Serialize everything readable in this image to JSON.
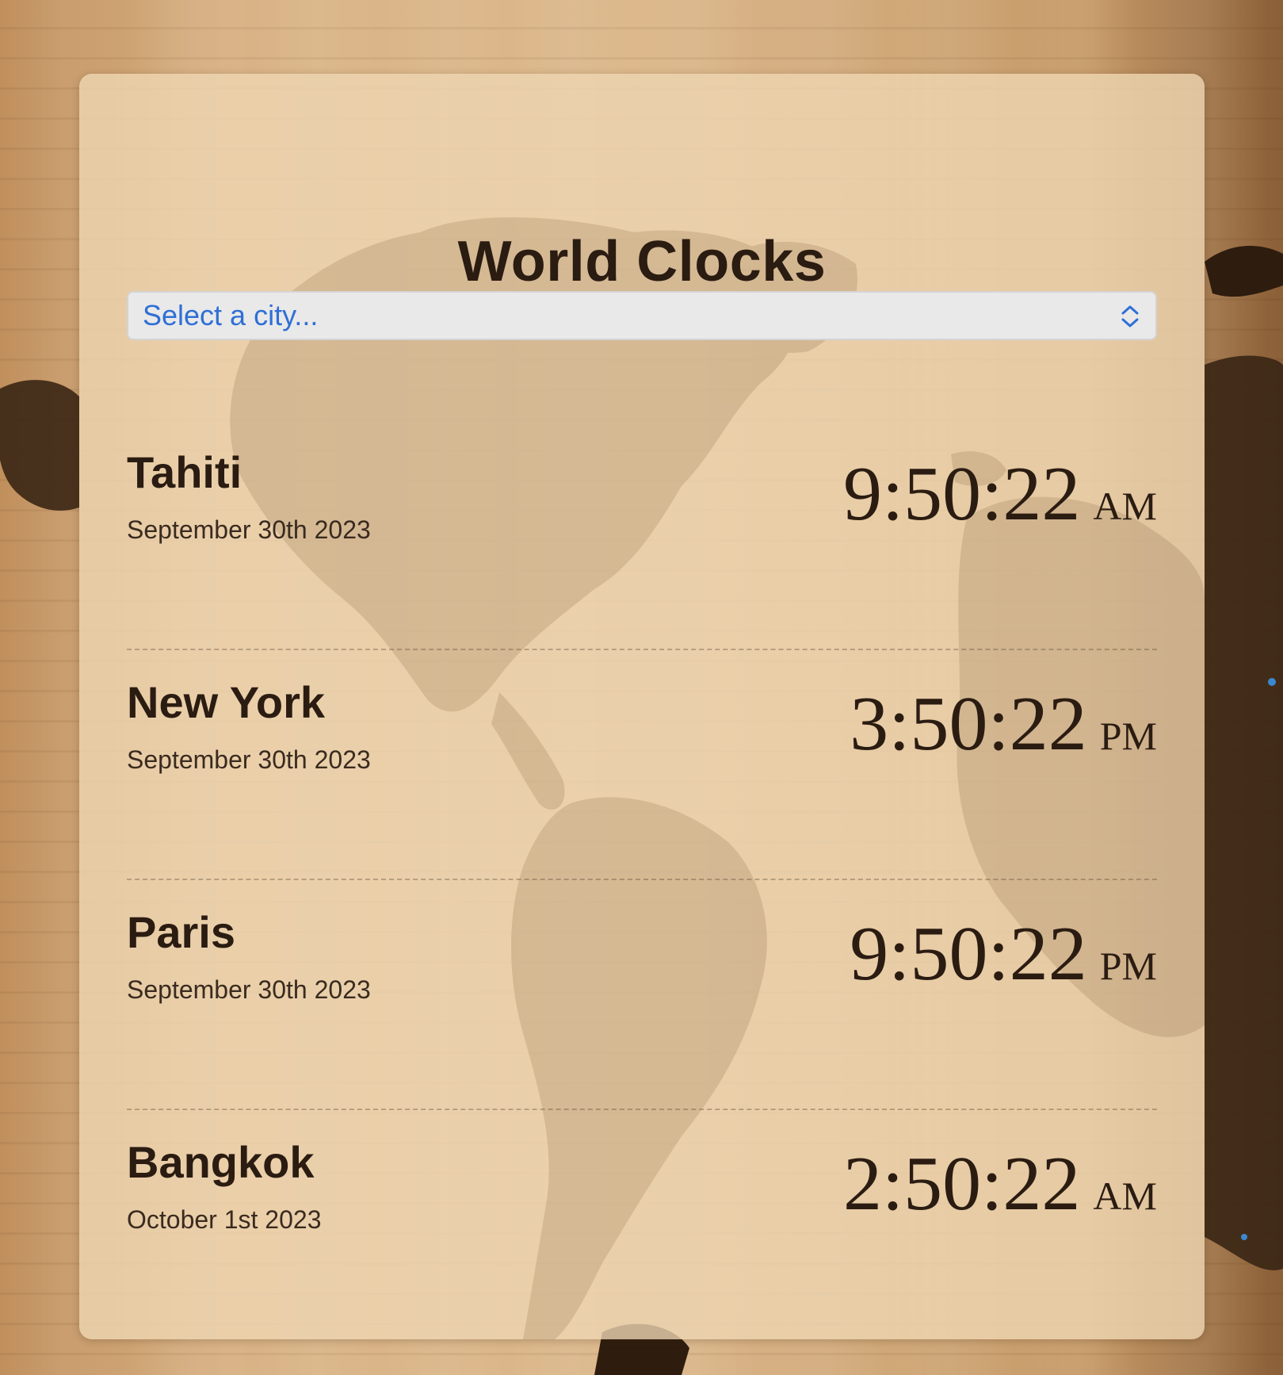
{
  "app": {
    "title": "World Clocks"
  },
  "city_select": {
    "placeholder": "Select a city..."
  },
  "clocks": [
    {
      "city": "Tahiti",
      "date": "September 30th 2023",
      "time": "9:50:22",
      "ampm": "AM"
    },
    {
      "city": "New York",
      "date": "September 30th 2023",
      "time": "3:50:22",
      "ampm": "PM"
    },
    {
      "city": "Paris",
      "date": "September 30th 2023",
      "time": "9:50:22",
      "ampm": "PM"
    },
    {
      "city": "Bangkok",
      "date": "October 1st 2023",
      "time": "2:50:22",
      "ampm": "AM"
    }
  ],
  "colors": {
    "accent": "#2f6fd6",
    "text": "#2b1c12",
    "card": "#eed6b2"
  },
  "icons": {
    "select": "chevron-up-down-icon"
  }
}
